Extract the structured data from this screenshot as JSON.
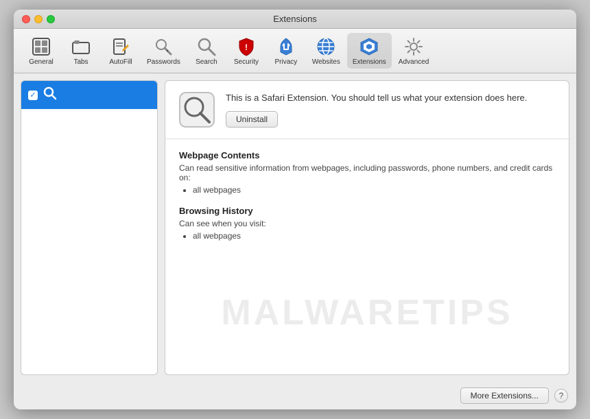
{
  "window": {
    "title": "Extensions"
  },
  "toolbar": {
    "items": [
      {
        "id": "general",
        "label": "General",
        "icon": "⊞",
        "active": false
      },
      {
        "id": "tabs",
        "label": "Tabs",
        "icon": "▭",
        "active": false
      },
      {
        "id": "autofill",
        "label": "AutoFill",
        "icon": "✏️",
        "active": false
      },
      {
        "id": "passwords",
        "label": "Passwords",
        "icon": "🔑",
        "active": false
      },
      {
        "id": "search",
        "label": "Search",
        "icon": "🔍",
        "active": false
      },
      {
        "id": "security",
        "label": "Security",
        "icon": "🔒",
        "active": false
      },
      {
        "id": "privacy",
        "label": "Privacy",
        "icon": "✋",
        "active": false
      },
      {
        "id": "websites",
        "label": "Websites",
        "icon": "🌐",
        "active": false
      },
      {
        "id": "extensions",
        "label": "Extensions",
        "icon": "⚡",
        "active": true
      },
      {
        "id": "advanced",
        "label": "Advanced",
        "icon": "⚙️",
        "active": false
      }
    ]
  },
  "sidebar": {
    "items": [
      {
        "id": "search-ext",
        "label": "Search",
        "checked": true,
        "selected": true
      }
    ]
  },
  "extension": {
    "description": "This is a Safari Extension. You should tell us what your extension does here.",
    "uninstall_label": "Uninstall",
    "sections": [
      {
        "title": "Webpage Contents",
        "description": "Can read sensitive information from webpages, including passwords, phone numbers, and credit cards on:",
        "items": [
          "all webpages"
        ]
      },
      {
        "title": "Browsing History",
        "description": "Can see when you visit:",
        "items": [
          "all webpages"
        ]
      }
    ]
  },
  "footer": {
    "more_extensions_label": "More Extensions...",
    "help_label": "?"
  },
  "watermark": {
    "text": "MALWARETIPS"
  },
  "traffic_lights": {
    "close": "close",
    "minimize": "minimize",
    "maximize": "maximize"
  }
}
